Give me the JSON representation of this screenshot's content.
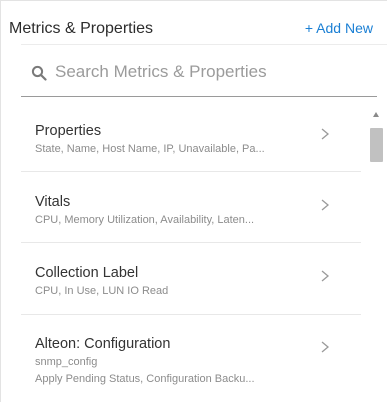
{
  "header": {
    "title": "Metrics & Properties",
    "add_new_label": "+ Add New"
  },
  "search": {
    "placeholder": "Search Metrics & Properties"
  },
  "items": [
    {
      "title": "Properties",
      "subtitle": "State, Name, Host Name, IP, Unavailable, Pa..."
    },
    {
      "title": "Vitals",
      "subtitle": "CPU, Memory Utilization, Availability, Laten..."
    },
    {
      "title": "Collection Label",
      "subtitle": "CPU, In Use, LUN IO Read"
    },
    {
      "title": "Alteon: Configuration",
      "subtitle": "snmp_config",
      "subtitle2": "Apply Pending Status, Configuration Backu..."
    }
  ],
  "colors": {
    "accent": "#1a7fd4",
    "text": "#333333",
    "muted": "#8c8c8c"
  }
}
